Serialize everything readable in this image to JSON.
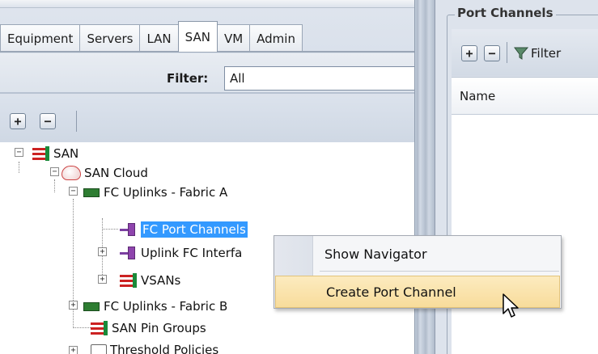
{
  "navigation": {
    "tabs": [
      {
        "label": "Equipment"
      },
      {
        "label": "Servers"
      },
      {
        "label": "LAN"
      },
      {
        "label": "SAN",
        "active": true
      },
      {
        "label": "VM"
      },
      {
        "label": "Admin"
      }
    ],
    "filter": {
      "label": "Filter:",
      "value": "All"
    },
    "toolbar": {
      "expand_icon": "plus-box-icon",
      "collapse_icon": "minus-box-icon"
    }
  },
  "tree": {
    "items": [
      {
        "label": "SAN",
        "icon": "san-icon",
        "expanded": true
      },
      {
        "label": "SAN Cloud",
        "icon": "cloud-icon",
        "expanded": true
      },
      {
        "label": "FC Uplinks - Fabric A",
        "icon": "fabric-interconnect-icon",
        "expanded": true
      },
      {
        "label": "FC Port Channels",
        "icon": "port-channel-icon",
        "selected": true
      },
      {
        "label": "Uplink FC Interfa",
        "icon": "port-channel-icon",
        "expanded": false
      },
      {
        "label": "VSANs",
        "icon": "san-icon",
        "expanded": false
      },
      {
        "label": "FC Uplinks - Fabric B",
        "icon": "fabric-interconnect-icon",
        "expanded": false
      },
      {
        "label": "SAN Pin Groups",
        "icon": "san-icon"
      },
      {
        "label": "Threshold Policies",
        "icon": "threshold-icon"
      }
    ]
  },
  "content": {
    "title": "Port Channels",
    "toolbar": {
      "filter_label": "Filter"
    },
    "table": {
      "columns": [
        "Name"
      ]
    }
  },
  "context_menu": {
    "items": [
      {
        "label": "Show Navigator"
      },
      {
        "label": "Create Port Channel",
        "hovered": true
      }
    ]
  },
  "colors": {
    "selection": "#3399ff",
    "menu_hover": "#fbe3a7",
    "san_red": "#cc2222",
    "san_green": "#1a8a3a"
  }
}
